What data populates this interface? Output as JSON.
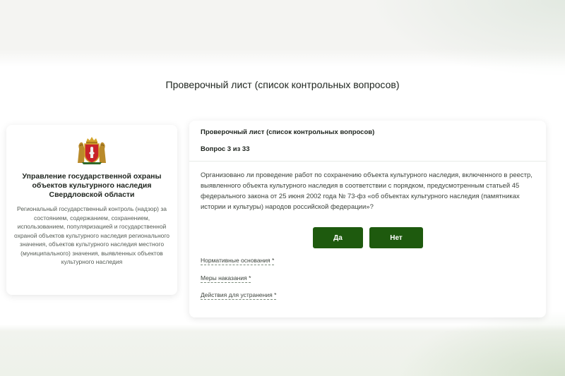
{
  "page": {
    "title": "Проверочный лист (список контрольных вопросов)"
  },
  "organization": {
    "emblem_icon": "sverdlovsk-coat-of-arms-icon",
    "title": "Управление государственной охраны объектов культурного наследия Свердловской области",
    "description": "Региональный государственный контроль (надзор) за состоянием, содержанием, сохранением, использованием, популяризацией и государственной охраной объектов культурного наследия регионального значения, объектов культурного наследия местного (муниципального) значения, выявленных объектов культурного наследия"
  },
  "questionnaire": {
    "header": "Проверочный лист (список контрольных вопросов)",
    "counter": "Вопрос 3 из 33",
    "question": "Организовано ли проведение работ по сохранению объекта культурного наследия, включенного в реестр, выявленного объекта культурного наследия в соответствии с порядком, предусмотренным статьей 45 федерального закона от 25 июня 2002 года № 73-фз «об объектах культурного наследия (памятниках истории и культуры) народов российской федерации»?",
    "yes_label": "Да",
    "no_label": "Нет",
    "fields": {
      "normative": "Нормативные основания *",
      "penalties": "Меры наказания *",
      "actions": "Действия для устранения *"
    }
  },
  "colors": {
    "accent": "#1e5a0e",
    "text": "#1e241e",
    "muted": "#555c55"
  }
}
